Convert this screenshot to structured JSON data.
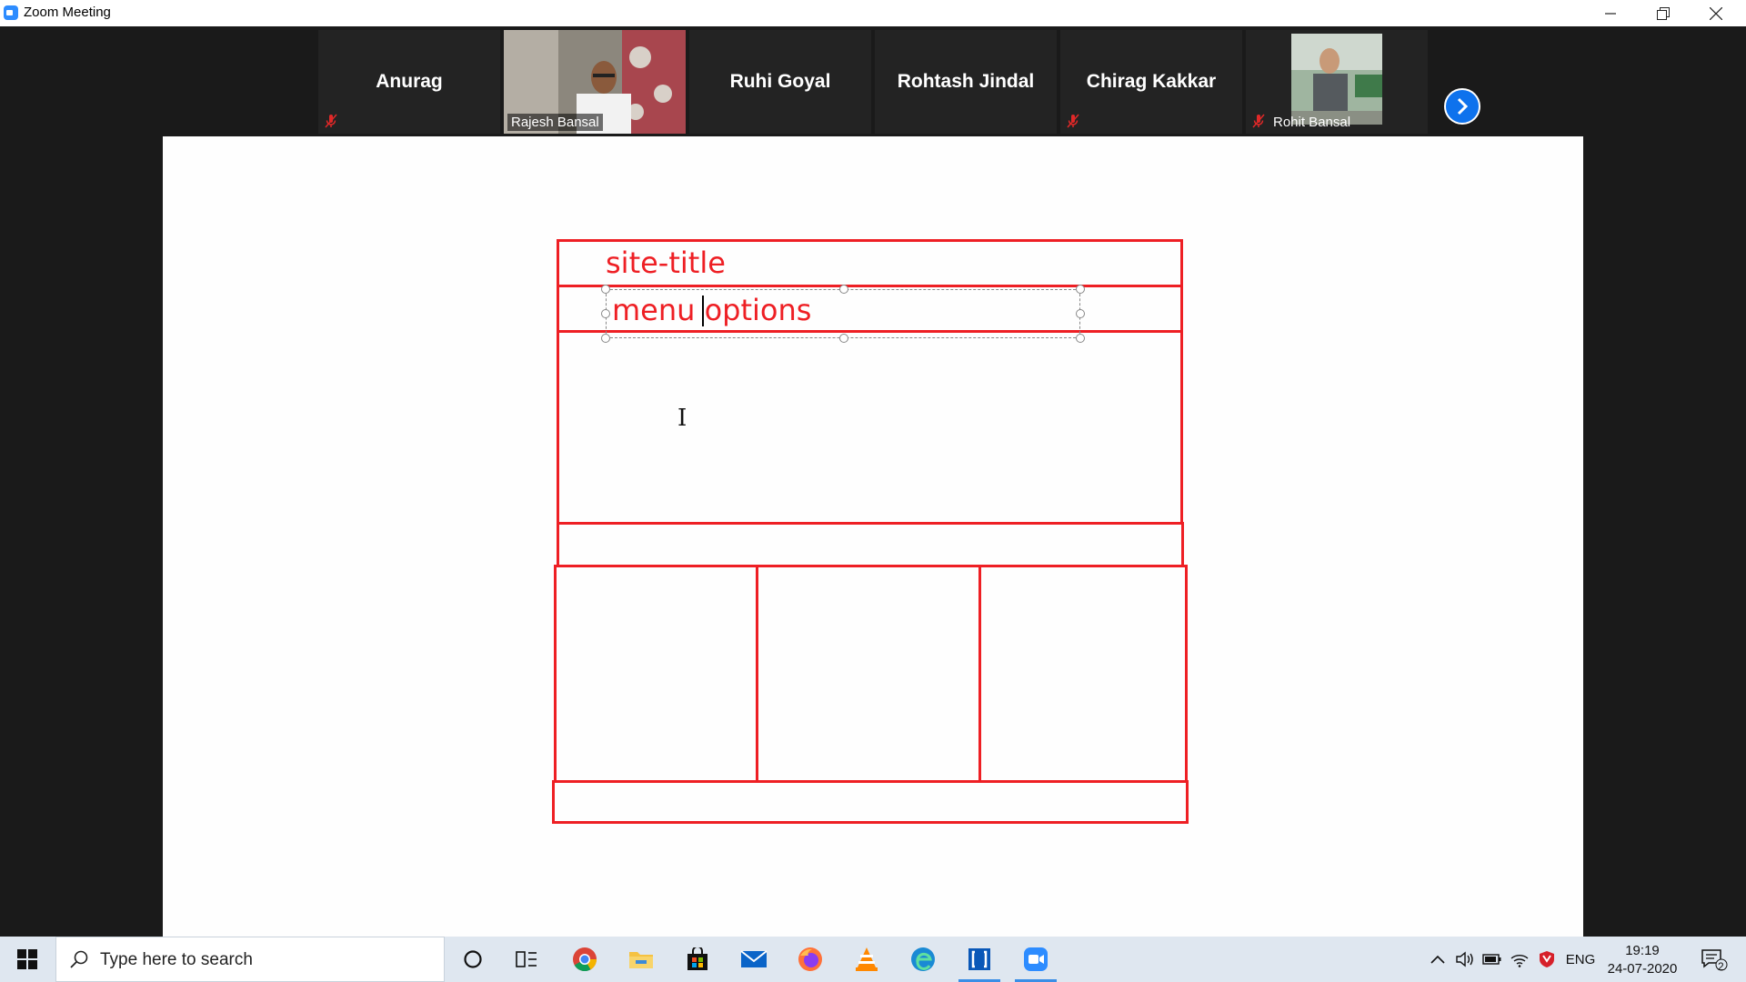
{
  "window": {
    "title": "Zoom Meeting",
    "controls": [
      "minimize",
      "restore",
      "close"
    ]
  },
  "participants": [
    {
      "name": "Anurag",
      "muted": true,
      "video": false
    },
    {
      "name": "Rajesh Bansal",
      "muted": false,
      "video": true,
      "active_speaker": true
    },
    {
      "name": "Ruhi Goyal",
      "muted": false,
      "video": false
    },
    {
      "name": "Rohtash Jindal",
      "muted": false,
      "video": false
    },
    {
      "name": "Chirag Kakkar",
      "muted": true,
      "video": false
    },
    {
      "name": "Rohit Bansal",
      "muted": true,
      "video": true
    }
  ],
  "participant_nav": {
    "icon": "chevron-right-icon"
  },
  "shared_screen": {
    "texts": {
      "site_title": "site-title",
      "menu_options": "menu options"
    },
    "colors": {
      "wire": "#ee1f24"
    }
  },
  "taskbar": {
    "search_placeholder": "Type here to search",
    "apps": [
      "cortana-icon",
      "task-view-icon",
      "chrome-icon",
      "file-explorer-icon",
      "store-icon",
      "mail-icon",
      "firefox-icon",
      "vlc-icon",
      "edge-icon",
      "snipping-icon",
      "zoom-icon"
    ],
    "tray": {
      "language": "ENG",
      "time": "19:19",
      "date": "24-07-2020",
      "notification_count": "2"
    }
  }
}
